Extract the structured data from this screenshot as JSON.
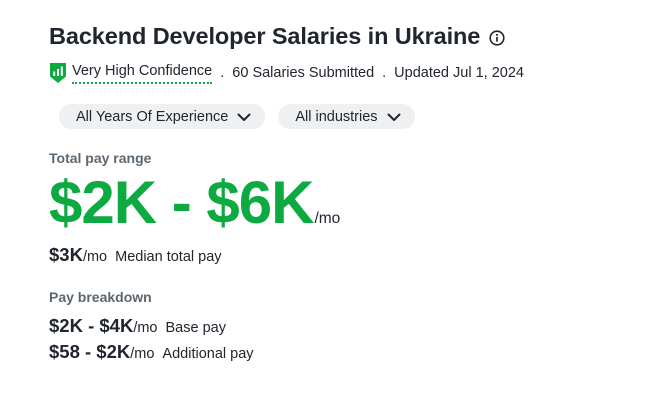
{
  "header": {
    "title": "Backend Developer Salaries in Ukraine",
    "info_icon": "info-icon"
  },
  "meta": {
    "confidence_icon": "bar-chart-shield-icon",
    "confidence_color": "#0caa41",
    "confidence_label": "Very High Confidence",
    "separator": ".",
    "salaries_submitted": "60 Salaries Submitted",
    "updated": "Updated Jul 1, 2024"
  },
  "filters": {
    "experience": "All Years Of Experience",
    "industries": "All industries",
    "chevron_icon": "chevron-down-icon"
  },
  "total_pay": {
    "label": "Total pay range",
    "range": "$2K - $6K",
    "unit": "/mo",
    "accent_color": "#0caa41",
    "median_amount": "$3K",
    "median_unit": "/mo",
    "median_label": "Median total pay"
  },
  "breakdown": {
    "label": "Pay breakdown",
    "base_amount": "$2K - $4K",
    "base_unit": "/mo",
    "base_label": "Base pay",
    "additional_amount": "$58 - $2K",
    "additional_unit": "/mo",
    "additional_label": "Additional pay"
  }
}
